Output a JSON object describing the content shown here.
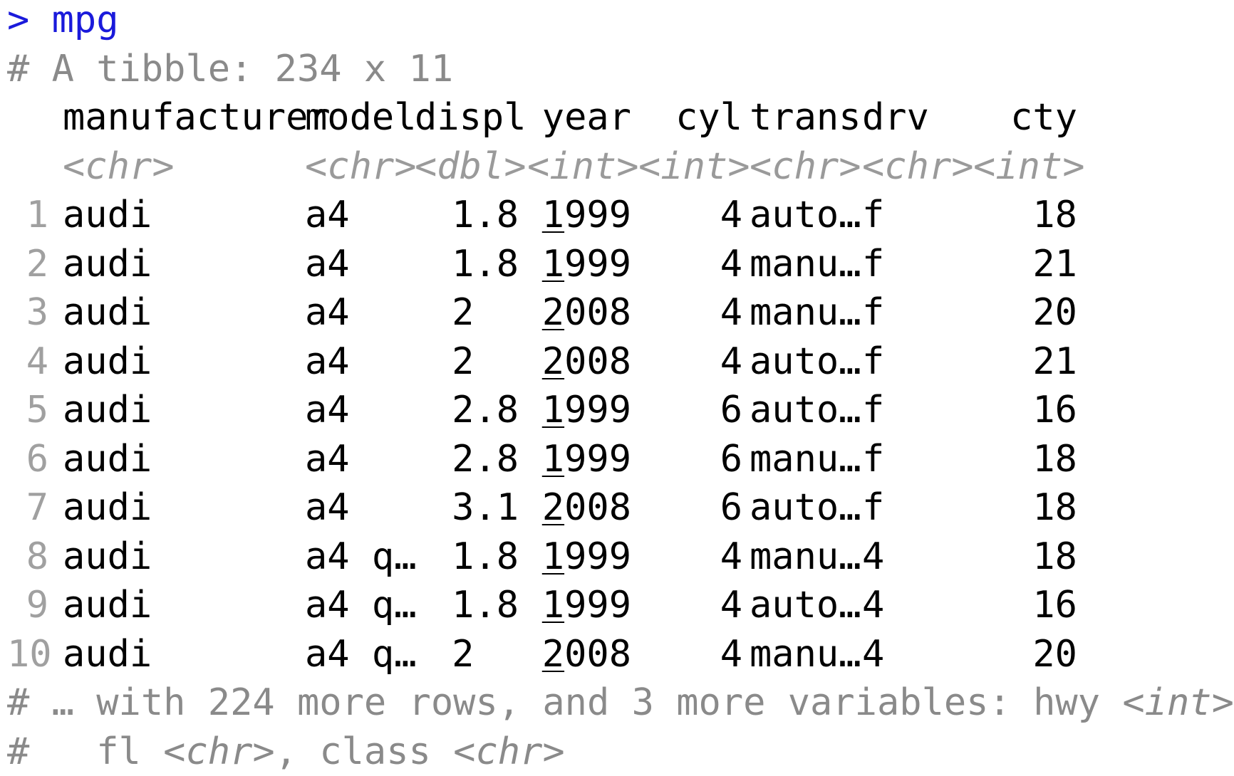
{
  "console": {
    "prompt_symbol": ">",
    "command": "mpg",
    "tibble_header": "# A tibble: 234 x 11"
  },
  "table": {
    "columns": [
      {
        "name": "manufacturer",
        "type": "<chr>",
        "align": "left"
      },
      {
        "name": "model",
        "type": "<chr>",
        "align": "left"
      },
      {
        "name": "displ",
        "type": "<dbl>",
        "align": "right"
      },
      {
        "name": "year",
        "type": "<int>",
        "align": "right"
      },
      {
        "name": "cyl",
        "type": "<int>",
        "align": "right"
      },
      {
        "name": "trans",
        "type": "<chr>",
        "align": "left"
      },
      {
        "name": "drv",
        "type": "<chr>",
        "align": "left"
      },
      {
        "name": "cty",
        "type": "<int>",
        "align": "right"
      }
    ],
    "rows": [
      {
        "n": "1",
        "year_lead": "1",
        "year_rest": "999",
        "cells": [
          "audi",
          "a4",
          "1.8",
          "",
          "4",
          "auto…",
          "f",
          "18"
        ]
      },
      {
        "n": "2",
        "year_lead": "1",
        "year_rest": "999",
        "cells": [
          "audi",
          "a4",
          "1.8",
          "",
          "4",
          "manu…",
          "f",
          "21"
        ]
      },
      {
        "n": "3",
        "year_lead": "2",
        "year_rest": "008",
        "cells": [
          "audi",
          "a4",
          "2  ",
          "",
          "4",
          "manu…",
          "f",
          "20"
        ]
      },
      {
        "n": "4",
        "year_lead": "2",
        "year_rest": "008",
        "cells": [
          "audi",
          "a4",
          "2  ",
          "",
          "4",
          "auto…",
          "f",
          "21"
        ]
      },
      {
        "n": "5",
        "year_lead": "1",
        "year_rest": "999",
        "cells": [
          "audi",
          "a4",
          "2.8",
          "",
          "6",
          "auto…",
          "f",
          "16"
        ]
      },
      {
        "n": "6",
        "year_lead": "1",
        "year_rest": "999",
        "cells": [
          "audi",
          "a4",
          "2.8",
          "",
          "6",
          "manu…",
          "f",
          "18"
        ]
      },
      {
        "n": "7",
        "year_lead": "2",
        "year_rest": "008",
        "cells": [
          "audi",
          "a4",
          "3.1",
          "",
          "6",
          "auto…",
          "f",
          "18"
        ]
      },
      {
        "n": "8",
        "year_lead": "1",
        "year_rest": "999",
        "cells": [
          "audi",
          "a4 q…",
          "1.8",
          "",
          "4",
          "manu…",
          "4",
          "18"
        ]
      },
      {
        "n": "9",
        "year_lead": "1",
        "year_rest": "999",
        "cells": [
          "audi",
          "a4 q…",
          "1.8",
          "",
          "4",
          "auto…",
          "4",
          "16"
        ]
      },
      {
        "n": "10",
        "year_lead": "2",
        "year_rest": "008",
        "cells": [
          "audi",
          "a4 q…",
          "2  ",
          "",
          "4",
          "manu…",
          "4",
          "20"
        ]
      }
    ]
  },
  "footer": {
    "line1_prefix": "# … with 224 more rows, and 3 more variables: hwy ",
    "line1_type": "<int>",
    "line1_suffix": ",",
    "line2_prefix": "#   fl ",
    "line2_type1": "<chr>",
    "line2_mid": ", class ",
    "line2_type2": "<chr>"
  },
  "colors": {
    "prompt": "#1a1adb",
    "comment": "#8a8a8a",
    "type_annotation": "#9a9a9a",
    "row_number": "#a0a0a0",
    "text": "#000000"
  }
}
